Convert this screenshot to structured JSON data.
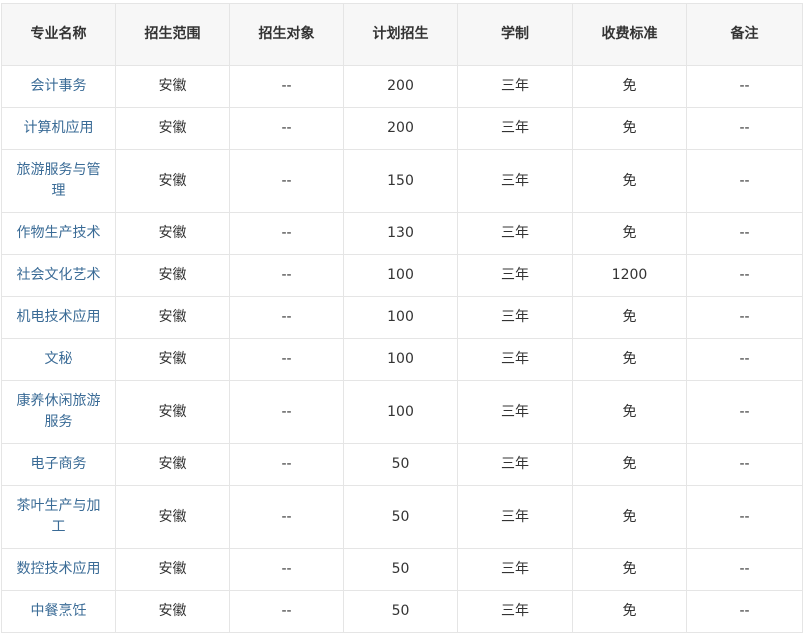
{
  "table": {
    "headers": [
      "专业名称",
      "招生范围",
      "招生对象",
      "计划招生",
      "学制",
      "收费标准",
      "备注"
    ],
    "rows": [
      {
        "major": "会计事务",
        "scope": "安徽",
        "target": "--",
        "plan": "200",
        "years": "三年",
        "fee": "免",
        "note": "--"
      },
      {
        "major": "计算机应用",
        "scope": "安徽",
        "target": "--",
        "plan": "200",
        "years": "三年",
        "fee": "免",
        "note": "--"
      },
      {
        "major": "旅游服务与管理",
        "scope": "安徽",
        "target": "--",
        "plan": "150",
        "years": "三年",
        "fee": "免",
        "note": "--"
      },
      {
        "major": "作物生产技术",
        "scope": "安徽",
        "target": "--",
        "plan": "130",
        "years": "三年",
        "fee": "免",
        "note": "--"
      },
      {
        "major": "社会文化艺术",
        "scope": "安徽",
        "target": "--",
        "plan": "100",
        "years": "三年",
        "fee": "1200",
        "note": "--"
      },
      {
        "major": "机电技术应用",
        "scope": "安徽",
        "target": "--",
        "plan": "100",
        "years": "三年",
        "fee": "免",
        "note": "--"
      },
      {
        "major": "文秘",
        "scope": "安徽",
        "target": "--",
        "plan": "100",
        "years": "三年",
        "fee": "免",
        "note": "--"
      },
      {
        "major": "康养休闲旅游服务",
        "scope": "安徽",
        "target": "--",
        "plan": "100",
        "years": "三年",
        "fee": "免",
        "note": "--"
      },
      {
        "major": "电子商务",
        "scope": "安徽",
        "target": "--",
        "plan": "50",
        "years": "三年",
        "fee": "免",
        "note": "--"
      },
      {
        "major": "茶叶生产与加工",
        "scope": "安徽",
        "target": "--",
        "plan": "50",
        "years": "三年",
        "fee": "免",
        "note": "--"
      },
      {
        "major": "数控技术应用",
        "scope": "安徽",
        "target": "--",
        "plan": "50",
        "years": "三年",
        "fee": "免",
        "note": "--"
      },
      {
        "major": "中餐烹饪",
        "scope": "安徽",
        "target": "--",
        "plan": "50",
        "years": "三年",
        "fee": "免",
        "note": "--"
      }
    ]
  }
}
